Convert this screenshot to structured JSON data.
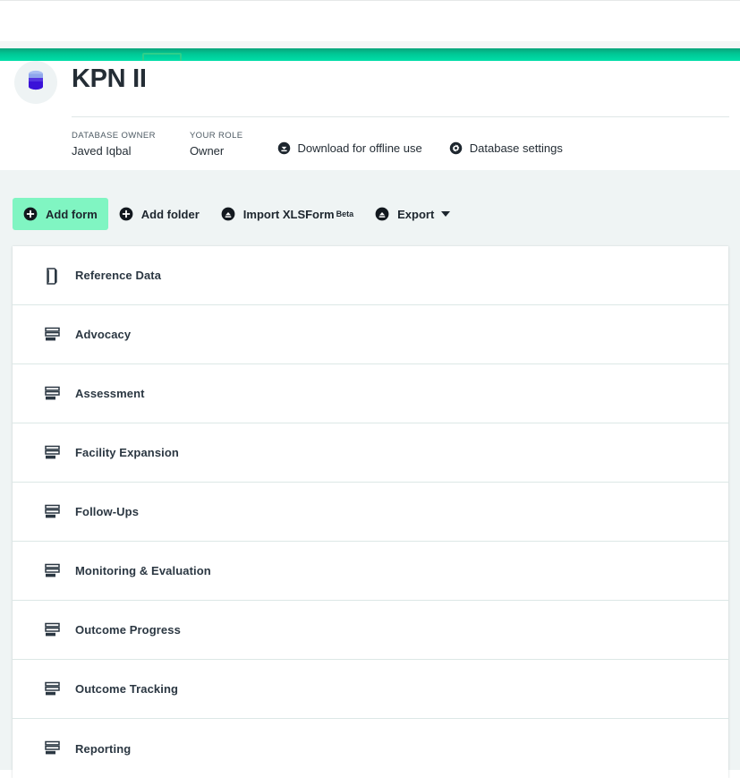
{
  "header": {
    "database_icon": "database-cylinder-icon",
    "title": "KPN II",
    "meta": [
      {
        "label": "DATABASE OWNER",
        "value": "Javed Iqbal"
      },
      {
        "label": "YOUR ROLE",
        "value": "Owner"
      }
    ],
    "actions": [
      {
        "icon": "cloud-download-icon",
        "label": "Download for offline use"
      },
      {
        "icon": "gear-icon",
        "label": "Database settings"
      }
    ]
  },
  "toolbar": {
    "add_form": {
      "icon": "plus-circle-icon",
      "label": "Add form",
      "active": true
    },
    "add_folder": {
      "icon": "plus-circle-icon",
      "label": "Add folder"
    },
    "import_xlsform": {
      "icon": "upload-circle-icon",
      "label": "Import XLSForm",
      "badge": "Beta"
    },
    "export": {
      "icon": "upload-circle-icon",
      "label": "Export",
      "caret": "chevron-down-icon"
    }
  },
  "list": {
    "items": [
      {
        "icon": "folder-icon",
        "label": "Reference Data"
      },
      {
        "icon": "form-icon",
        "label": "Advocacy"
      },
      {
        "icon": "form-icon",
        "label": "Assessment"
      },
      {
        "icon": "form-icon",
        "label": "Facility Expansion"
      },
      {
        "icon": "form-icon",
        "label": "Follow-Ups"
      },
      {
        "icon": "form-icon",
        "label": "Monitoring & Evaluation"
      },
      {
        "icon": "form-icon",
        "label": "Outcome Progress"
      },
      {
        "icon": "form-icon",
        "label": "Outcome Tracking"
      },
      {
        "icon": "form-icon",
        "label": "Reporting"
      }
    ]
  },
  "colors": {
    "accent_green": "#00c896",
    "highlight_mint": "#80f5c2",
    "page_background": "#eff4f4",
    "divider": "#dce8e6",
    "text": "#2b3742",
    "db_icon_top": "#9bb3ef",
    "db_icon_body": "#3a12d8"
  }
}
